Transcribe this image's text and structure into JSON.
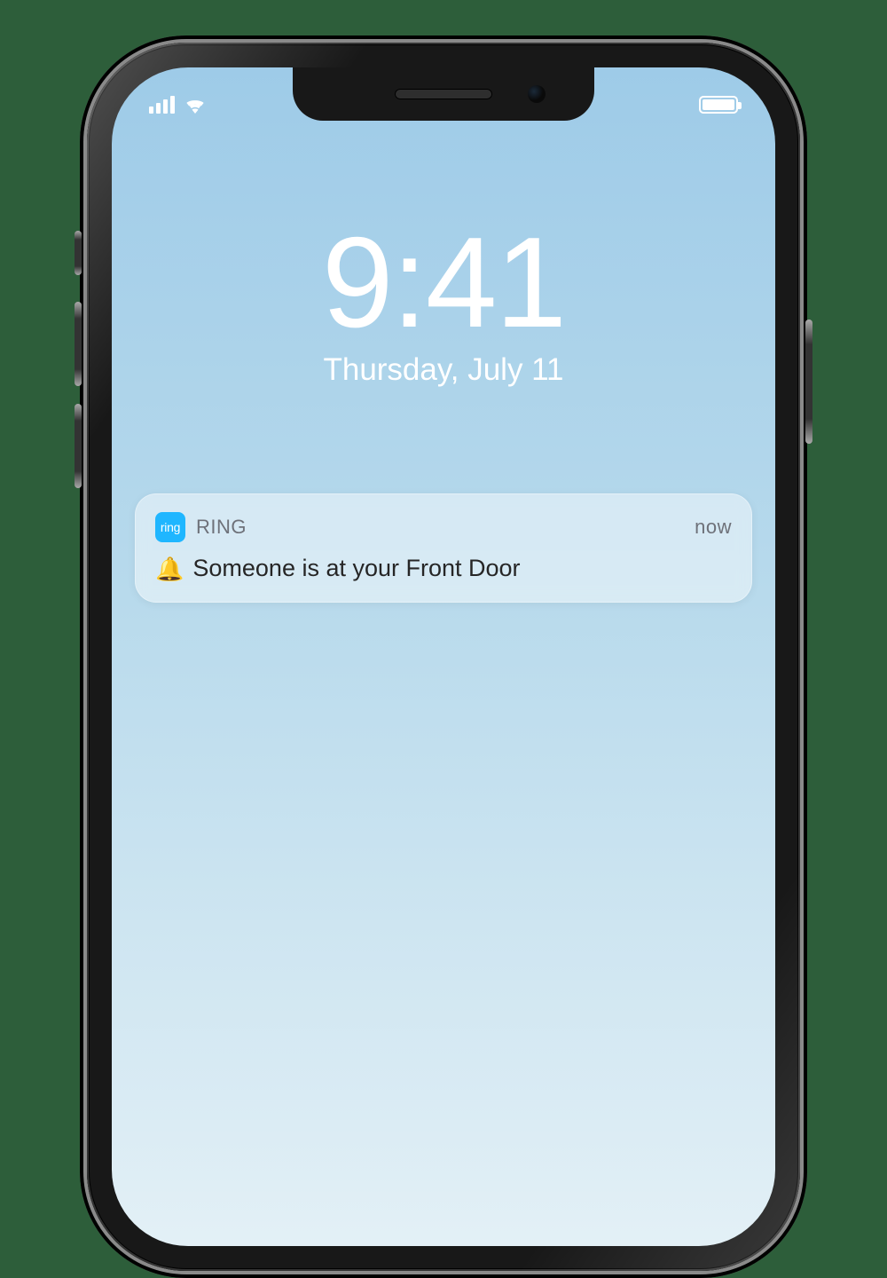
{
  "status_bar": {
    "carrier_bars": 4,
    "wifi": "wifi-icon",
    "battery_full": true
  },
  "lock_screen": {
    "time": "9:41",
    "date": "Thursday, July 11"
  },
  "notification": {
    "app_icon_label": "ring",
    "app_name": "RING",
    "time_ago": "now",
    "emoji": "🔔",
    "message": "Someone is at your Front Door"
  }
}
